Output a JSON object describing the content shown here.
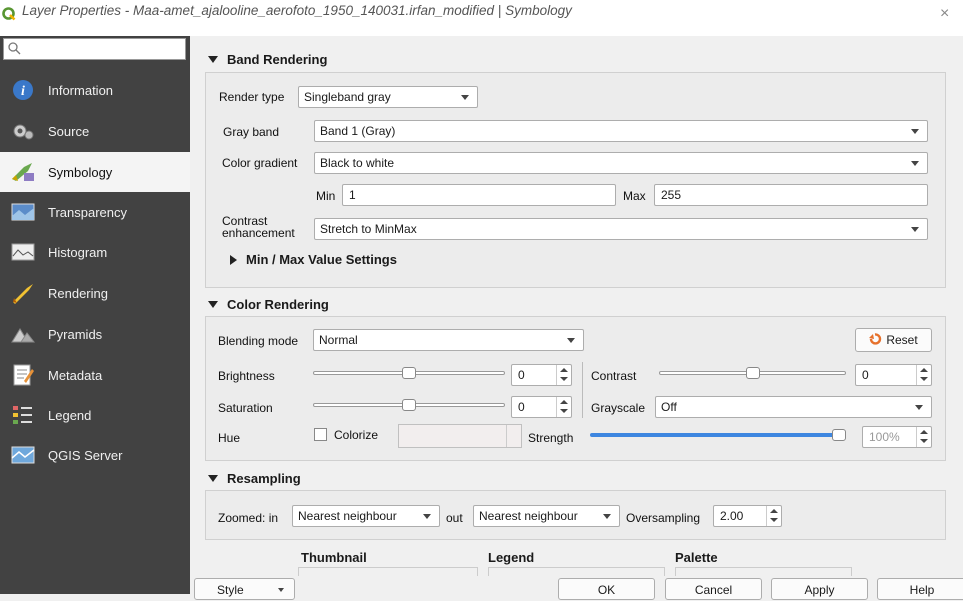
{
  "window": {
    "title": "Layer Properties - Maa-amet_ajalooline_aerofoto_1950_140031.irfan_modified | Symbology",
    "close": "×"
  },
  "search": {
    "placeholder": ""
  },
  "sidebar": {
    "items": [
      {
        "label": "Information",
        "icon": "info-icon"
      },
      {
        "label": "Source",
        "icon": "source-icon"
      },
      {
        "label": "Symbology",
        "icon": "symbology-icon",
        "active": true
      },
      {
        "label": "Transparency",
        "icon": "transparency-icon"
      },
      {
        "label": "Histogram",
        "icon": "histogram-icon"
      },
      {
        "label": "Rendering",
        "icon": "rendering-icon"
      },
      {
        "label": "Pyramids",
        "icon": "pyramids-icon"
      },
      {
        "label": "Metadata",
        "icon": "metadata-icon"
      },
      {
        "label": "Legend",
        "icon": "legend-icon"
      },
      {
        "label": "QGIS Server",
        "icon": "qgis-server-icon"
      }
    ]
  },
  "band_rendering": {
    "title": "Band Rendering",
    "render_type_label": "Render type",
    "render_type_value": "Singleband gray",
    "gray_band_label": "Gray band",
    "gray_band_value": "Band 1 (Gray)",
    "color_gradient_label": "Color gradient",
    "color_gradient_value": "Black to white",
    "min_label": "Min",
    "min_value": "1",
    "max_label": "Max",
    "max_value": "255",
    "contrast_label_1": "Contrast",
    "contrast_label_2": "enhancement",
    "contrast_value": "Stretch to MinMax",
    "minmax_settings": "Min / Max Value Settings"
  },
  "color_rendering": {
    "title": "Color Rendering",
    "blending_label": "Blending mode",
    "blending_value": "Normal",
    "reset_label": "Reset",
    "brightness_label": "Brightness",
    "brightness_value": "0",
    "contrast_label": "Contrast",
    "contrast_value": "0",
    "saturation_label": "Saturation",
    "saturation_value": "0",
    "grayscale_label": "Grayscale",
    "grayscale_value": "Off",
    "hue_label": "Hue",
    "colorize_label": "Colorize",
    "strength_label": "Strength",
    "strength_value": "100%",
    "brightness_level": 0.5,
    "saturation_level": 0.5,
    "contrast_level": 0.5,
    "strength_level": 1.0
  },
  "resampling": {
    "title": "Resampling",
    "zoomed_in_label": "Zoomed: in",
    "zoomed_in_value": "Nearest neighbour",
    "out_label": "out",
    "out_value": "Nearest neighbour",
    "oversampling_label": "Oversampling",
    "oversampling_value": "2.00"
  },
  "subtabs": {
    "thumbnail": "Thumbnail",
    "legend": "Legend",
    "palette": "Palette"
  },
  "footer": {
    "style": "Style",
    "ok": "OK",
    "cancel": "Cancel",
    "apply": "Apply",
    "help": "Help"
  },
  "colors": {
    "sidebar_bg": "#424242",
    "active_bg": "#f4f4f4",
    "slider_blue": "#3d86e0",
    "reset_orange": "#e6712c"
  }
}
